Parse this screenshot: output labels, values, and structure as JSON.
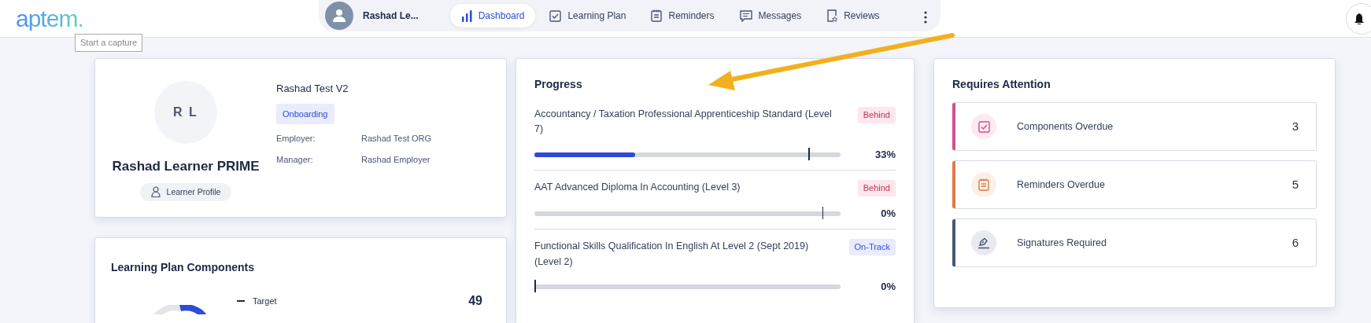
{
  "header": {
    "logo": "aptem.",
    "user": {
      "name": "Rashad Le..."
    },
    "nav": [
      {
        "label": "Dashboard",
        "kind": "bars",
        "selected": true
      },
      {
        "label": "Learning Plan",
        "kind": "checkbox",
        "selected": false
      },
      {
        "label": "Reminders",
        "kind": "notepad",
        "selected": false
      },
      {
        "label": "Messages",
        "kind": "chat",
        "selected": false
      },
      {
        "label": "Reviews",
        "kind": "review",
        "selected": false
      }
    ]
  },
  "tooltip": "Start a capture",
  "profile": {
    "initials": "R L",
    "name": "Rashad Learner PRIME",
    "button": "Learner Profile",
    "programme": "Rashad Test V2",
    "status": "Onboarding",
    "fields": [
      {
        "label": "Employer:",
        "value": "Rashad Test ORG"
      },
      {
        "label": "Manager:",
        "value": "Rashad Employer"
      }
    ]
  },
  "components": {
    "title": "Learning Plan Components",
    "legend": [
      {
        "label": "Target",
        "value": "49"
      }
    ]
  },
  "progress": {
    "title": "Progress",
    "items": [
      {
        "name": "Accountancy / Taxation Professional Apprenticeship Standard (Level 7)",
        "status": "Behind",
        "kind": "behind",
        "level": 0.33,
        "target": {
          "level": 0.895
        },
        "reading": "33%"
      },
      {
        "name": "AAT Advanced Diploma In Accounting (Level 3)",
        "status": "Behind",
        "kind": "behind",
        "target": {
          "level": 0.94
        },
        "reading": "0%"
      },
      {
        "name": "Functional Skills Qualification In English At Level 2 (Sept 2019) (Level 2)",
        "status": "On-Track",
        "kind": "on_track",
        "level": 0,
        "target": {
          "level": 0
        },
        "reading": "0%"
      }
    ]
  },
  "attention": {
    "title": "Requires Attention",
    "items": [
      {
        "label": "Components Overdue",
        "count": "3",
        "kind": "checkbox",
        "color": "#d34f8a"
      },
      {
        "label": "Reminders Overdue",
        "count": "5",
        "kind": "notepad",
        "color": "#e07a45"
      },
      {
        "label": "Signatures Required",
        "count": "6",
        "kind": "pen",
        "color": "#4a5578"
      }
    ]
  }
}
